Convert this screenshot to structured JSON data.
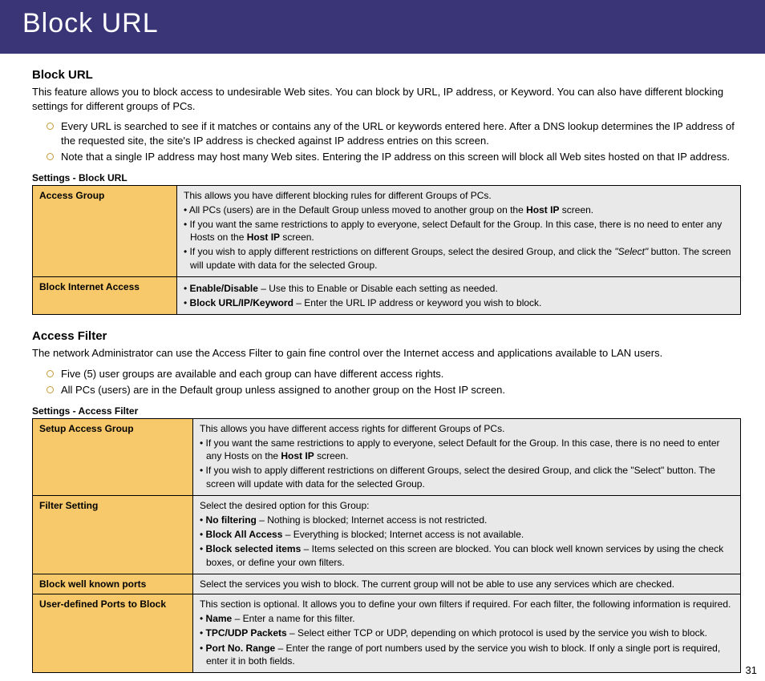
{
  "banner": {
    "title": "Block URL"
  },
  "section1": {
    "heading": "Block URL",
    "intro": "This feature allows you to block access to undesirable Web sites. You can block by URL, IP address, or Keyword.  You can also have different blocking settings for different groups of PCs.",
    "bullets": [
      "Every URL is searched to see if it matches or contains any of the URL or keywords entered here. After a DNS lookup determines the IP address of the requested site, the site's IP address is checked against IP address entries on this screen.",
      "Note that a single IP address may host many Web sites. Entering the IP address on this screen will block all Web sites hosted on that IP address."
    ],
    "table_caption": "Settings - Block URL",
    "rows": {
      "access_group": {
        "label": "Access Group",
        "line1": "This allows you have different blocking rules for different Groups of PCs.",
        "line2_pre": "• All PCs (users) are in the Default Group unless moved to another group on the ",
        "line2_bold": "Host IP",
        "line2_post": " screen.",
        "line3_pre": "• If you want the same restrictions to apply to everyone, select Default for the Group. In this case, there is no need to enter any Hosts on the ",
        "line3_bold": "Host IP",
        "line3_post": " screen.",
        "line4_pre": "• If you wish to apply different restrictions on different Groups, select the desired Group, and click the ",
        "line4_ital": "\"Select\"",
        "line4_post": " button. The screen will update with data for the selected Group."
      },
      "block_internet": {
        "label": "Block Internet Access",
        "line1_bold": "Enable/Disable",
        "line1_post": " – Use this to Enable or Disable each setting as needed.",
        "line2_bold": "Block URL/IP/Keyword",
        "line2_post": " – Enter the URL IP address or keyword you wish to block."
      }
    }
  },
  "section2": {
    "heading": "Access Filter",
    "intro": "The network Administrator can use the Access Filter to gain fine control over the Internet access and applications available to LAN users.",
    "bullets": [
      "Five (5) user groups are available and each group can have different access rights.",
      "All PCs (users) are in the Default group unless assigned to another group on the Host IP screen."
    ],
    "table_caption": "Settings - Access Filter",
    "rows": {
      "setup": {
        "label": "Setup Access Group",
        "line1": "This allows you have different access rights for different Groups of PCs.",
        "line2_pre": "• If you want the same restrictions to apply to everyone, select Default for the Group. In this case, there is no need to enter any Hosts on the ",
        "line2_bold": "Host IP",
        "line2_post": " screen.",
        "line3": "• If you wish to apply different restrictions on different Groups, select the desired Group, and click the \"Select\" button. The screen will update with data for the selected Group."
      },
      "filter": {
        "label": "Filter Setting",
        "line1": "Select the desired option for this Group:",
        "line2_bold": "No filtering",
        "line2_post": " – Nothing is blocked; Internet access is not restricted.",
        "line3_bold": "Block All Access",
        "line3_post": " – Everything is blocked; Internet access is not available.",
        "line4_bold": "Block selected items",
        "line4_post": " – Items selected on this screen are blocked. You can block well known services by using the check boxes, or define your own filters."
      },
      "ports": {
        "label": "Block well known ports",
        "desc": "Select the services you wish to block. The current group will not be able to use any services which are checked."
      },
      "user_ports": {
        "label": "User-defined Ports to Block",
        "line1": "This section is optional. It allows you to define your own filters if required. For each filter, the following information is required.",
        "line2_bold": "Name",
        "line2_post": " – Enter a name for this filter.",
        "line3_bold": "TPC/UDP Packets",
        "line3_post": " – Select either TCP or UDP, depending on which protocol is used by the service you wish to block.",
        "line4_bold": "Port No. Range",
        "line4_post": " – Enter the range of port numbers used by the service you wish to block. If only a single port is required, enter it in both fields."
      }
    }
  },
  "pagenum": "31"
}
